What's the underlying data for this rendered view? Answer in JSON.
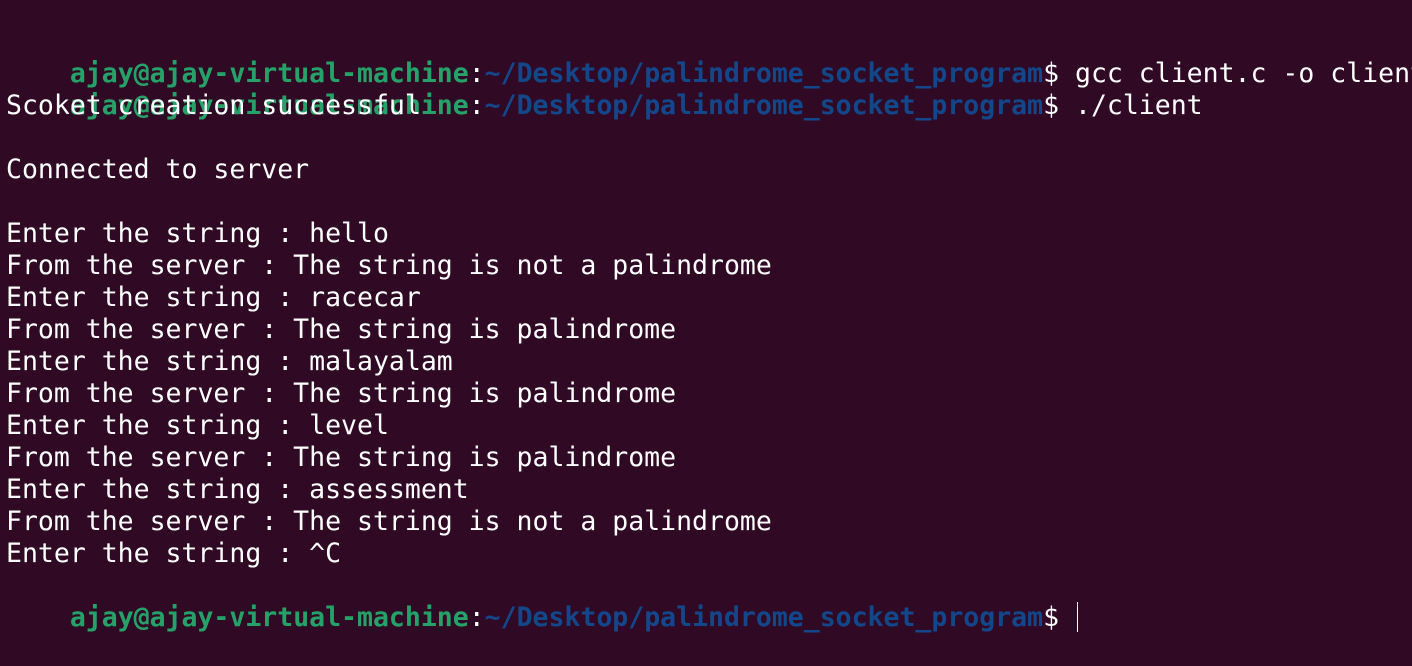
{
  "prompt": {
    "user_host": "ajay@ajay-virtual-machine",
    "colon": ":",
    "path": "~/Desktop/palindrome_socket_program",
    "symbol": "$"
  },
  "commands": [
    " gcc client.c -o client",
    " ./client"
  ],
  "output": [
    "Scoket creation successful",
    "",
    "Connected to server",
    "",
    "Enter the string : hello",
    "From the server : The string is not a palindrome",
    "Enter the string : racecar",
    "From the server : The string is palindrome",
    "Enter the string : malayalam",
    "From the server : The string is palindrome",
    "Enter the string : level",
    "From the server : The string is palindrome",
    "Enter the string : assessment",
    "From the server : The string is not a palindrome",
    "Enter the string : ^C"
  ],
  "final_input": " ",
  "colors": {
    "background": "#300a24",
    "user_host": "#26a269",
    "path": "#12488b",
    "text": "#ffffff"
  }
}
